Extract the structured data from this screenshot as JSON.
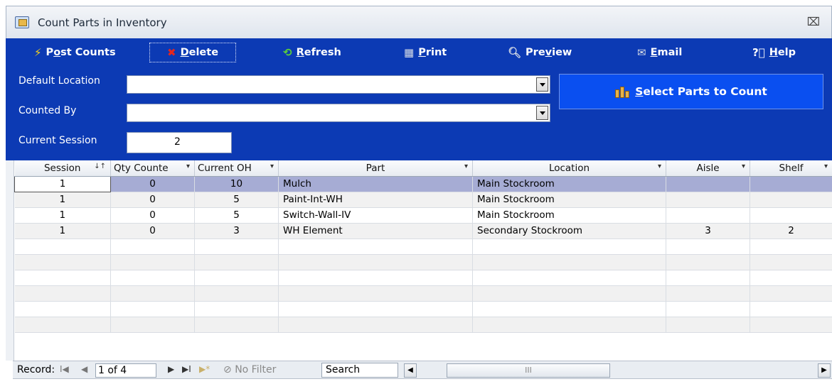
{
  "window": {
    "title": "Count Parts in Inventory",
    "close_glyph": "⌧"
  },
  "toolbar": {
    "post_counts": {
      "label_pre": "P",
      "label_u": "o",
      "label_post": "st Counts",
      "icon": "lightning-icon"
    },
    "delete": {
      "label_pre": "",
      "label_u": "D",
      "label_post": "elete",
      "icon": "delete-x-icon"
    },
    "refresh": {
      "label_pre": "",
      "label_u": "R",
      "label_post": "efresh",
      "icon": "refresh-icon"
    },
    "print": {
      "label_pre": "",
      "label_u": "P",
      "label_post": "rint",
      "icon": "printer-icon"
    },
    "preview": {
      "label_pre": "Pre",
      "label_u": "v",
      "label_post": "iew",
      "icon": "magnifier-icon"
    },
    "email": {
      "label_pre": "",
      "label_u": "E",
      "label_post": "mail",
      "icon": "envelope-icon"
    },
    "help": {
      "label_pre": "",
      "label_u": "H",
      "label_post": "elp",
      "icon": "help-circle-icon"
    }
  },
  "form": {
    "default_location_label": "Default Location",
    "default_location_value": "",
    "counted_by_label": "Counted By",
    "counted_by_value": "",
    "current_session_label": "Current Session",
    "current_session_value": "2",
    "select_parts_pre": "",
    "select_parts_u": "S",
    "select_parts_post": "elect Parts to Count"
  },
  "grid": {
    "columns": [
      {
        "label": "Session",
        "arrow": "↓↑"
      },
      {
        "label": "Qty Counte",
        "arrow": "▾"
      },
      {
        "label": "Current OH",
        "arrow": "▾"
      },
      {
        "label": "Part",
        "arrow": "▾"
      },
      {
        "label": "Location",
        "arrow": "▾"
      },
      {
        "label": "Aisle",
        "arrow": "▾"
      },
      {
        "label": "Shelf",
        "arrow": "▾"
      }
    ],
    "rows": [
      {
        "session": "1",
        "qty": "0",
        "oh": "10",
        "part": "Mulch",
        "location": "Main Stockroom",
        "aisle": "",
        "shelf": ""
      },
      {
        "session": "1",
        "qty": "0",
        "oh": "5",
        "part": "Paint-Int-WH",
        "location": "Main Stockroom",
        "aisle": "",
        "shelf": ""
      },
      {
        "session": "1",
        "qty": "0",
        "oh": "5",
        "part": "Switch-Wall-IV",
        "location": "Main Stockroom",
        "aisle": "",
        "shelf": ""
      },
      {
        "session": "1",
        "qty": "0",
        "oh": "3",
        "part": "WH Element",
        "location": "Secondary Stockroom",
        "aisle": "3",
        "shelf": "2"
      }
    ]
  },
  "record_nav": {
    "label": "Record:",
    "first": "I◀",
    "prev": "◀",
    "position": "1 of 4",
    "next": "▶",
    "last": "▶I",
    "new": "▶*",
    "no_filter": "No Filter",
    "search": "Search",
    "scroll_thumb": "III"
  }
}
